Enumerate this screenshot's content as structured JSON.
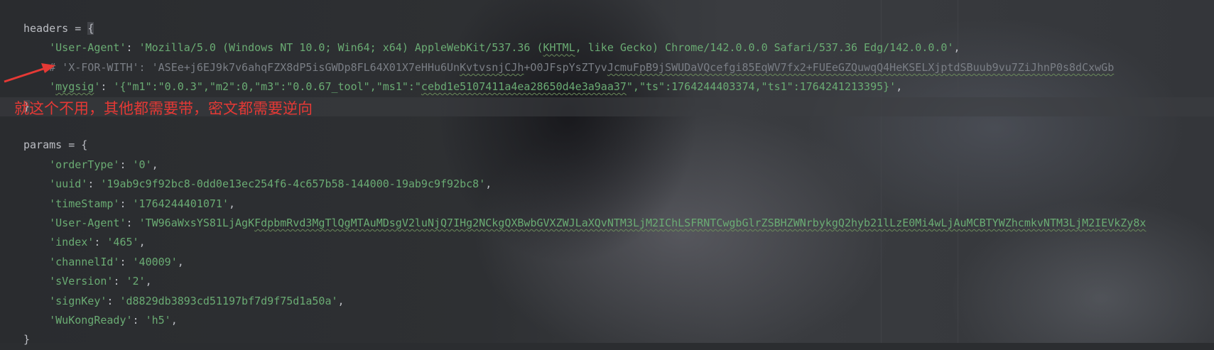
{
  "editor": {
    "lines": [
      {
        "tokens": [
          {
            "t": "headers = ",
            "k": "p"
          },
          {
            "t": "{",
            "k": "p brace-hl"
          }
        ]
      },
      {
        "tokens": [
          {
            "t": "    ",
            "k": "p"
          },
          {
            "t": "'User-Agent'",
            "k": "s"
          },
          {
            "t": ": ",
            "k": "p"
          },
          {
            "t": "'Mozilla/5.0 (Windows NT 10.0; Win64; x64) AppleWebKit/537.36 (",
            "k": "s"
          },
          {
            "t": "KHTML",
            "k": "s w"
          },
          {
            "t": ", like Gecko) Chrome/142.0.0.0 Safari/537.36 Edg/142.0.0.0'",
            "k": "s"
          },
          {
            "t": ",",
            "k": "p"
          }
        ]
      },
      {
        "tokens": [
          {
            "t": "    # 'X-FOR-WITH': 'ASEe+j6EJ9k7v6ahqFZX8dP5isGWDp8FL64X01X7eHHu6Un",
            "k": "c"
          },
          {
            "t": "KvtvsnjCJh",
            "k": "c w"
          },
          {
            "t": "+O0JFspYsZTyv",
            "k": "c"
          },
          {
            "t": "JcmuFpB9jSWUDaVQcefgi85EqWV7fx2+FUEeGZQuwqQ4HeKSELXjptdSBuub9vu7ZiJhnP0s8dCxwGb",
            "k": "c w"
          }
        ]
      },
      {
        "tokens": [
          {
            "t": "    ",
            "k": "p"
          },
          {
            "t": "'",
            "k": "s"
          },
          {
            "t": "mygsig",
            "k": "s w"
          },
          {
            "t": "'",
            "k": "s"
          },
          {
            "t": ": ",
            "k": "p"
          },
          {
            "t": "'{\"m1\":\"0.0.3\",\"m2\":0,\"m3\":\"0.0.67_tool\",\"ms1\":\"",
            "k": "s"
          },
          {
            "t": "cebd1e5107411a4ea28650d4e3a9aa37",
            "k": "s w"
          },
          {
            "t": "\",\"ts\":1764244403374,\"ts1\":1764241213395}'",
            "k": "s"
          },
          {
            "t": ",",
            "k": "p"
          }
        ]
      },
      {
        "tokens": [
          {
            "t": "}",
            "k": "p brace-hl"
          }
        ]
      },
      {
        "tokens": []
      },
      {
        "tokens": [
          {
            "t": "params = {",
            "k": "p"
          }
        ]
      },
      {
        "tokens": [
          {
            "t": "    ",
            "k": "p"
          },
          {
            "t": "'orderType'",
            "k": "s"
          },
          {
            "t": ": ",
            "k": "p"
          },
          {
            "t": "'0'",
            "k": "s"
          },
          {
            "t": ",",
            "k": "p"
          }
        ]
      },
      {
        "tokens": [
          {
            "t": "    ",
            "k": "p"
          },
          {
            "t": "'uuid'",
            "k": "s"
          },
          {
            "t": ": ",
            "k": "p"
          },
          {
            "t": "'19ab9c9f92bc8-0dd0e13ec254f6-4c657b58-144000-19ab9c9f92bc8'",
            "k": "s"
          },
          {
            "t": ",",
            "k": "p"
          }
        ]
      },
      {
        "tokens": [
          {
            "t": "    ",
            "k": "p"
          },
          {
            "t": "'timeStamp'",
            "k": "s"
          },
          {
            "t": ": ",
            "k": "p"
          },
          {
            "t": "'1764244401071'",
            "k": "s"
          },
          {
            "t": ",",
            "k": "p"
          }
        ]
      },
      {
        "tokens": [
          {
            "t": "    ",
            "k": "p"
          },
          {
            "t": "'User-Agent'",
            "k": "s"
          },
          {
            "t": ": ",
            "k": "p"
          },
          {
            "t": "'TW96aWxsYS81LjAgK",
            "k": "s"
          },
          {
            "t": "FdpbmRvd3MgTlQgMTAuMDsgV2luNjQ7IHg2NCkgQXBwbGVXZWJLaXQvNTM3LjM2IChLSFRNTCwgbGlrZSBHZWNrbykgQ2hyb21lLzE0Mi4wLjAuMCBTYWZhcmkvNTM3LjM2IEVkZy8x",
            "k": "s w"
          }
        ]
      },
      {
        "tokens": [
          {
            "t": "    ",
            "k": "p"
          },
          {
            "t": "'index'",
            "k": "s"
          },
          {
            "t": ": ",
            "k": "p"
          },
          {
            "t": "'465'",
            "k": "s"
          },
          {
            "t": ",",
            "k": "p"
          }
        ]
      },
      {
        "tokens": [
          {
            "t": "    ",
            "k": "p"
          },
          {
            "t": "'channelId'",
            "k": "s"
          },
          {
            "t": ": ",
            "k": "p"
          },
          {
            "t": "'40009'",
            "k": "s"
          },
          {
            "t": ",",
            "k": "p"
          }
        ]
      },
      {
        "tokens": [
          {
            "t": "    ",
            "k": "p"
          },
          {
            "t": "'sVersion'",
            "k": "s"
          },
          {
            "t": ": ",
            "k": "p"
          },
          {
            "t": "'2'",
            "k": "s"
          },
          {
            "t": ",",
            "k": "p"
          }
        ]
      },
      {
        "tokens": [
          {
            "t": "    ",
            "k": "p"
          },
          {
            "t": "'signKey'",
            "k": "s"
          },
          {
            "t": ": ",
            "k": "p"
          },
          {
            "t": "'d8829db3893cd51197bf7d9f75d1a50a'",
            "k": "s"
          },
          {
            "t": ",",
            "k": "p"
          }
        ]
      },
      {
        "tokens": [
          {
            "t": "    ",
            "k": "p"
          },
          {
            "t": "'WuKongReady'",
            "k": "s"
          },
          {
            "t": ": ",
            "k": "p"
          },
          {
            "t": "'h5'",
            "k": "s"
          },
          {
            "t": ",",
            "k": "p"
          }
        ]
      },
      {
        "tokens": [
          {
            "t": "}",
            "k": "p"
          }
        ]
      }
    ]
  },
  "annotation": {
    "note": "就这个不用，其他都需要带，密文都需要逆向",
    "color": "#e53935"
  }
}
